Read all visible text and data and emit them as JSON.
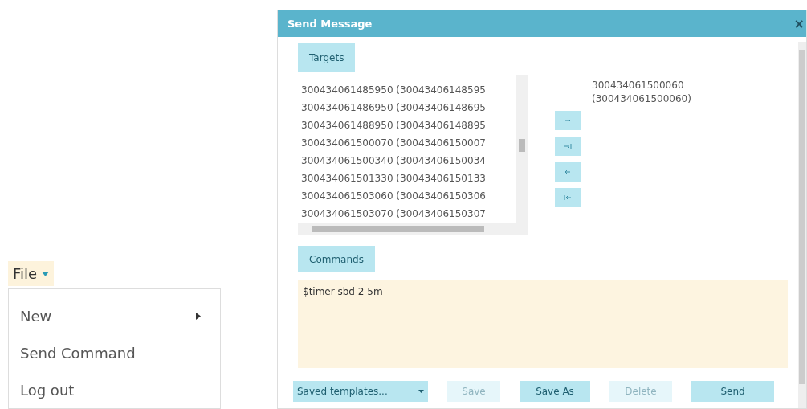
{
  "file_menu": {
    "label": "File",
    "items": [
      {
        "label": "New",
        "kind": "submenu"
      },
      {
        "label": "Send Command",
        "kind": "action"
      },
      {
        "label": "Log out",
        "kind": "action"
      }
    ]
  },
  "dialog": {
    "title": "Send Message",
    "close": "×",
    "targets_label": "Targets",
    "available_targets": [
      "300434061485950 (30043406148595",
      "300434061486950 (30043406148695",
      "300434061488950 (30043406148895",
      "300434061500070 (30043406150007",
      "300434061500340 (30043406150034",
      "300434061501330 (30043406150133",
      "300434061503060 (30043406150306",
      "300434061503070 (30043406150307"
    ],
    "move_buttons": [
      {
        "kind": "add"
      },
      {
        "kind": "add_all"
      },
      {
        "kind": "remove"
      },
      {
        "kind": "remove_all"
      }
    ],
    "selected_targets": [
      "300434061500060 (300434061500060)"
    ],
    "commands_label": "Commands",
    "command_text": "$timer sbd 2 5m",
    "templates": "Saved templates...",
    "buttons": [
      {
        "label": "Save",
        "disabled": true
      },
      {
        "label": "Save As",
        "disabled": false
      },
      {
        "label": "Delete",
        "disabled": true
      },
      {
        "label": "Send",
        "disabled": false
      }
    ]
  }
}
